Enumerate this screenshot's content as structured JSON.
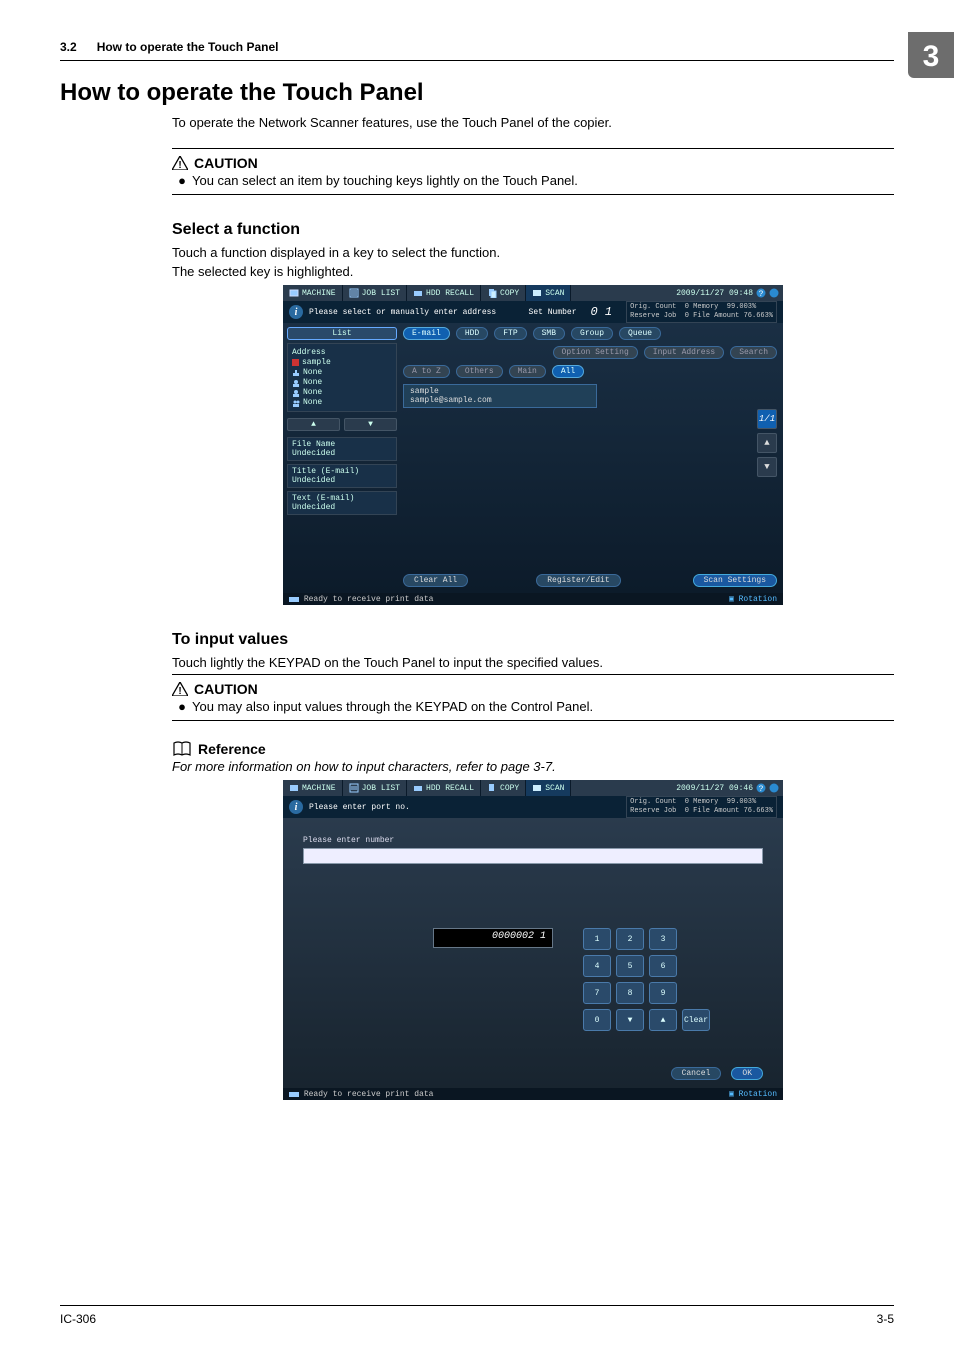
{
  "running_head": {
    "section_num": "3.2",
    "section_title": "How to operate the Touch Panel"
  },
  "chapter_badge": "3",
  "heading": {
    "num": "3.2",
    "title": "How to operate the Touch Panel"
  },
  "intro": "To operate the Network Scanner features, use the Touch Panel of the copier.",
  "caution1": {
    "label": "CAUTION",
    "bullet": "You can select an item by touching keys lightly on the Touch Panel."
  },
  "select_fn": {
    "heading": "Select a function",
    "p1": "Touch a function displayed in a key to select the function.",
    "p2": "The selected key is highlighted."
  },
  "input_vals": {
    "heading": "To input values",
    "p1": "Touch lightly the KEYPAD on the Touch Panel to input the specified values."
  },
  "caution2": {
    "label": "CAUTION",
    "bullet": "You may also input values through the KEYPAD on the Control Panel."
  },
  "reference": {
    "label": "Reference",
    "text": "For more information on how to input characters, refer to page 3-7."
  },
  "footer": {
    "left": "IC-306",
    "right": "3-5"
  },
  "ss1": {
    "tabs": {
      "machine": "MACHINE",
      "joblist": "JOB LIST",
      "hddrecall": "HDD RECALL",
      "copy": "COPY",
      "scan": "SCAN"
    },
    "clock": "2009/11/27 09:48",
    "info_msg": "Please select or manually enter address",
    "set_number_label": "Set Number",
    "set_number_value": "0 1",
    "meta": {
      "orig_count_label": "Orig. Count",
      "orig_count_val": "0",
      "reserve_label": "Reserve Job",
      "reserve_val": "0",
      "memory_label": "Memory",
      "memory_val": "99.003%",
      "file_label": "File Amount",
      "file_val": "76.663%"
    },
    "list_btn": "List",
    "address_label": "Address",
    "address_items": [
      "sample",
      "None",
      "None",
      "None",
      "None"
    ],
    "filename": {
      "label": "File Name",
      "value": "Undecided"
    },
    "title_em": {
      "label": "Title (E-mail)",
      "value": "Undecided"
    },
    "text_em": {
      "label": "Text (E-mail)",
      "value": "Undecided"
    },
    "dest_tabs": {
      "email": "E-mail",
      "hdd": "HDD",
      "ftp": "FTP",
      "smb": "SMB",
      "group": "Group",
      "queue": "Queue"
    },
    "row2": {
      "opt": "Option Setting",
      "inp": "Input Address",
      "search": "Search"
    },
    "row3": {
      "atoz": "A to Z",
      "others": "Others",
      "main": "Main",
      "all": "All"
    },
    "entry": {
      "name": "sample",
      "addr": "sample@sample.com"
    },
    "counter": "1/1",
    "bottom": {
      "clear": "Clear All",
      "regedit": "Register/Edit",
      "scanset": "Scan Settings"
    },
    "status": "Ready to receive print data",
    "rotation": "Rotation"
  },
  "ss2": {
    "tabs": {
      "machine": "MACHINE",
      "joblist": "JOB LIST",
      "hddrecall": "HDD RECALL",
      "copy": "COPY",
      "scan": "SCAN"
    },
    "clock": "2009/11/27 09:46",
    "info_msg": "Please enter port no.",
    "meta": {
      "orig_count_label": "Orig. Count",
      "orig_count_val": "0",
      "reserve_label": "Reserve Job",
      "reserve_val": "0",
      "memory_label": "Memory",
      "memory_val": "99.003%",
      "file_label": "File Amount",
      "file_val": "76.663%"
    },
    "prompt": "Please enter number",
    "display": "0000002 1",
    "keys": [
      "1",
      "2",
      "3",
      "4",
      "5",
      "6",
      "7",
      "8",
      "9",
      "0",
      "▼",
      "▲",
      "Clear"
    ],
    "actions": {
      "cancel": "Cancel",
      "ok": "OK"
    },
    "status": "Ready to receive print data",
    "rotation": "Rotation"
  }
}
